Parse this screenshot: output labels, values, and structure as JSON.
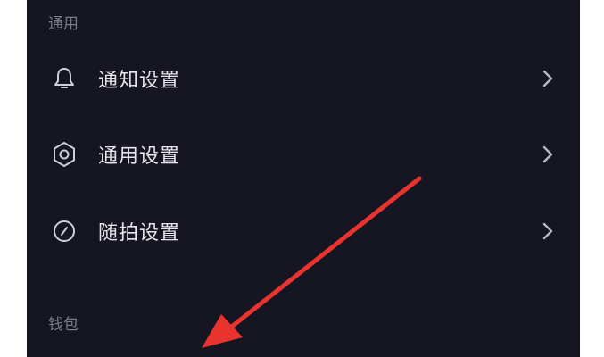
{
  "sections": {
    "general": {
      "title": "通用"
    },
    "wallet": {
      "title": "钱包"
    }
  },
  "settings_items": [
    {
      "label": "通知设置",
      "icon": "bell-icon"
    },
    {
      "label": "通用设置",
      "icon": "gear-icon"
    },
    {
      "label": "随拍设置",
      "icon": "camera-shot-icon"
    }
  ],
  "colors": {
    "background": "#161622",
    "text_primary": "#e6e6ea",
    "text_secondary": "#7c7c86",
    "annotation_arrow": "#e8332f"
  }
}
